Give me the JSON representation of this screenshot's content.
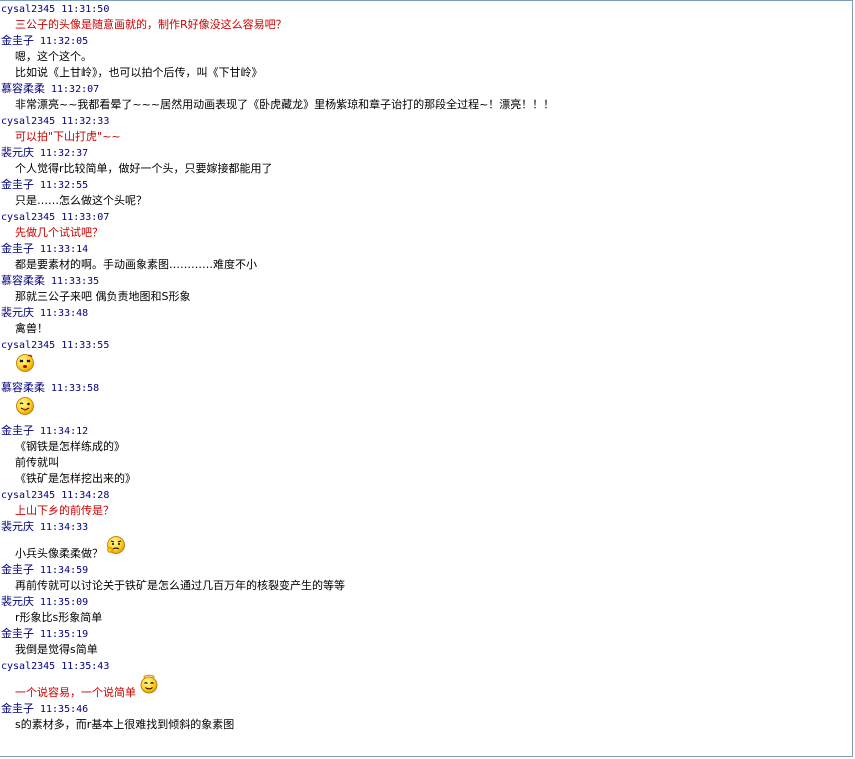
{
  "messages": [
    {
      "user": "cysal2345",
      "time": "11:31:50",
      "lines": [
        {
          "text": "三公子的头像是随意画就的，制作R好像没这么容易吧？",
          "color": "red"
        }
      ]
    },
    {
      "user": "金圭子",
      "time": "11:32:05",
      "lines": [
        {
          "text": "嗯，这个这个。"
        },
        {
          "text": "比如说《上甘岭》，也可以拍个后传，叫《下甘岭》"
        }
      ]
    },
    {
      "user": "慕容柔柔",
      "time": "11:32:07",
      "lines": [
        {
          "text": "非常漂亮~~我都看晕了~~~居然用动画表现了《卧虎藏龙》里杨紫琼和章子诒打的那段全过程~！漂亮！！！"
        }
      ]
    },
    {
      "user": "cysal2345",
      "time": "11:32:33",
      "lines": [
        {
          "text": "可以拍\"下山打虎\"~~",
          "color": "red"
        }
      ]
    },
    {
      "user": "裴元庆",
      "time": "11:32:37",
      "lines": [
        {
          "text": "个人觉得r比较简单，做好一个头，只要嫁接都能用了"
        }
      ]
    },
    {
      "user": "金圭子",
      "time": "11:32:55",
      "lines": [
        {
          "text": "只是……怎么做这个头呢？"
        }
      ]
    },
    {
      "user": "cysal2345",
      "time": "11:33:07",
      "lines": [
        {
          "text": "先做几个试试吧？",
          "color": "red"
        }
      ]
    },
    {
      "user": "金圭子",
      "time": "11:33:14",
      "lines": [
        {
          "text": "都是要素材的啊。手动画象素图…………难度不小"
        }
      ]
    },
    {
      "user": "慕容柔柔",
      "time": "11:33:35",
      "lines": [
        {
          "text": "那就三公子来吧 偶负责地图和S形象"
        }
      ]
    },
    {
      "user": "裴元庆",
      "time": "11:33:48",
      "lines": [
        {
          "text": "禽兽！"
        }
      ]
    },
    {
      "user": "cysal2345",
      "time": "11:33:55",
      "lines": [
        {
          "emoji": "dizzy-face-icon"
        }
      ]
    },
    {
      "user": "慕容柔柔",
      "time": "11:33:58",
      "lines": [
        {
          "emoji": "tongue-face-icon"
        }
      ]
    },
    {
      "user": "金圭子",
      "time": "11:34:12",
      "lines": [
        {
          "text": "《钢铁是怎样练成的》"
        },
        {
          "text": "前传就叫"
        },
        {
          "text": "《铁矿是怎样挖出来的》"
        }
      ]
    },
    {
      "user": "cysal2345",
      "time": "11:34:28",
      "lines": [
        {
          "text": "上山下乡的前传是？",
          "color": "red"
        }
      ]
    },
    {
      "user": "裴元庆",
      "time": "11:34:33",
      "lines": [
        {
          "text": "小兵头像柔柔做？",
          "emoji": "thinking-face-icon"
        }
      ]
    },
    {
      "user": "金圭子",
      "time": "11:34:59",
      "lines": [
        {
          "text": "再前传就可以讨论关于铁矿是怎么通过几百万年的核裂变产生的等等"
        }
      ]
    },
    {
      "user": "裴元庆",
      "time": "11:35:09",
      "lines": [
        {
          "text": "r形象比s形象简单"
        }
      ]
    },
    {
      "user": "金圭子",
      "time": "11:35:19",
      "lines": [
        {
          "text": "我倒是觉得s简单"
        }
      ]
    },
    {
      "user": "cysal2345",
      "time": "11:35:43",
      "lines": [
        {
          "text": "一个说容易，一个说简单",
          "color": "red",
          "emoji": "angel-face-icon"
        }
      ]
    },
    {
      "user": "金圭子",
      "time": "11:35:46",
      "lines": [
        {
          "text": "s的素材多，而r基本上很难找到倾斜的象素图"
        }
      ]
    }
  ],
  "colors": {
    "header": "#000080",
    "text": "#000000",
    "highlight": "#cc0000",
    "border": "#7f9db9"
  }
}
